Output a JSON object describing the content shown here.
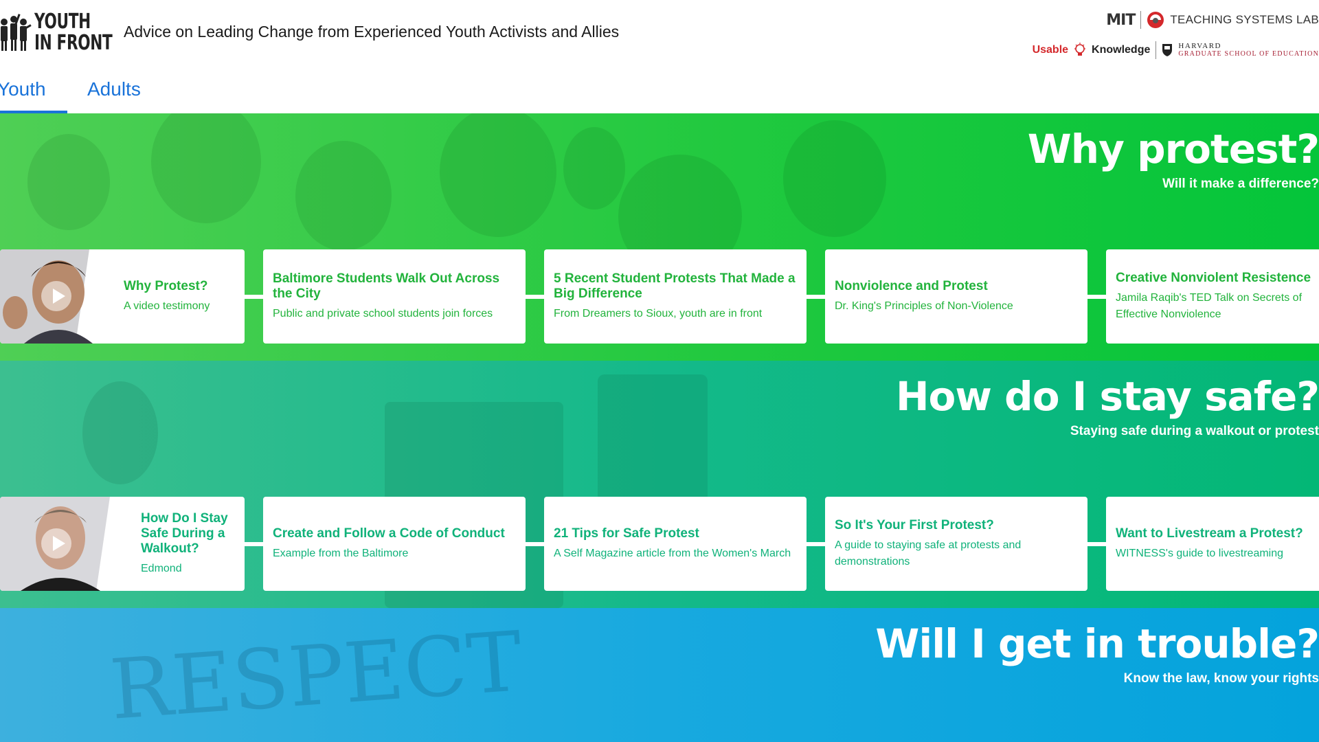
{
  "header": {
    "logo_line1": "YOUTH",
    "logo_line2": "IN FRONT",
    "tagline": "Advice on Leading Change from Experienced Youth Activists and Allies",
    "partners": {
      "mit": "MIT",
      "tsl": "TEACHING SYSTEMS LAB",
      "uk_usable": "Usable",
      "uk_knowledge": "Knowledge",
      "harvard_top": "HARVARD",
      "harvard_bottom": "GRADUATE SCHOOL OF EDUCATION"
    }
  },
  "tabs": [
    {
      "label": "Youth",
      "active": true
    },
    {
      "label": "Adults",
      "active": false
    }
  ],
  "sections": [
    {
      "title": "Why protest?",
      "subtitle": "Will it make a difference?",
      "cards": [
        {
          "title": "Why Protest?",
          "desc": "A video testimony",
          "video": true
        },
        {
          "title": "Baltimore Students Walk Out Across the City",
          "desc": "Public and private school students join forces"
        },
        {
          "title": "5 Recent Student Protests That Made a Big Difference",
          "desc": "From Dreamers to Sioux, youth are in front"
        },
        {
          "title": "Nonviolence and Protest",
          "desc": "Dr. King's Principles of Non-Violence"
        },
        {
          "title": "Creative Nonviolent Resistence",
          "desc": "Jamila Raqib's TED Talk on Secrets of Effective Nonviolence"
        }
      ]
    },
    {
      "title": "How do I stay safe?",
      "subtitle": "Staying safe during a walkout or protest",
      "cards": [
        {
          "title": "How Do I Stay Safe During a Walkout?",
          "desc": "Edmond",
          "video": true
        },
        {
          "title": "Create and Follow a Code of Conduct",
          "desc": "Example from the Baltimore"
        },
        {
          "title": "21 Tips for Safe Protest",
          "desc": "A Self Magazine article from the Women's March"
        },
        {
          "title": "So It's Your First Protest?",
          "desc": "A guide to staying safe at protests and demonstrations"
        },
        {
          "title": "Want to Livestream a Protest?",
          "desc": "WITNESS's guide to livestreaming"
        }
      ]
    },
    {
      "title": "Will I get in trouble?",
      "subtitle": "Know the law, know your rights",
      "background_word": "RESPECT"
    }
  ],
  "colors": {
    "tab_blue": "#1a73d9",
    "section1_green": "#21c93f",
    "section2_teal": "#14b98a",
    "section3_blue": "#18a9df",
    "card_text_green": "#22b33c",
    "card_text_teal": "#10b27a"
  },
  "icons": [
    "people-silhouette-icon",
    "play-icon",
    "lightbulb-icon",
    "shield-icon",
    "tsl-logo-icon"
  ]
}
